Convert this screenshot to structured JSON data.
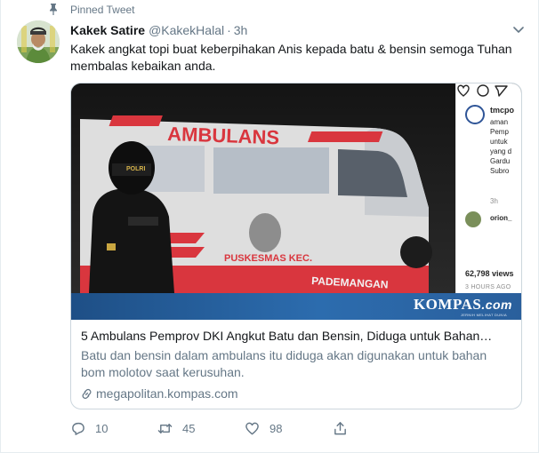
{
  "pinned": {
    "label": "Pinned Tweet"
  },
  "tweet": {
    "display_name": "Kakek Satire",
    "username": "@KakekHalal",
    "separator": "·",
    "time": "3h",
    "text": "Kakek angkat topi buat keberpihakan Anis kepada batu & bensin semoga Tuhan membalas kebaikan anda."
  },
  "media": {
    "ambulance_label": "AMBULANS",
    "vehicle_side_text": "PADEMANGAN",
    "vehicle_side_text_left": "PUSKESMAS KEC.",
    "helmet_label": "POLRI",
    "watermark": {
      "brand": "KOMPAS",
      "suffix": ".com",
      "tagline": "JERNIH MELIHAT DUNIA"
    },
    "instagram": {
      "handle": "tmcpo",
      "caption_lines": [
        "aman",
        "Pemp",
        "untuk",
        "yang d",
        "Gardu",
        "Subro"
      ],
      "time": "3h",
      "commenter": "orion_",
      "views": "62,798 views",
      "ago": "3 HOURS AGO"
    }
  },
  "card": {
    "title": "5 Ambulans Pemprov DKI Angkut Batu dan Bensin, Diduga untuk Bahan…",
    "description": "Batu dan bensin dalam ambulans itu diduga akan digunakan untuk bahan bom molotov saat kerusuhan.",
    "domain": "megapolitan.kompas.com"
  },
  "actions": {
    "replies": "10",
    "retweets": "45",
    "likes": "98"
  },
  "colors": {
    "text_primary": "#14171a",
    "text_secondary": "#657786",
    "border": "#ccd6dd",
    "kompas_blue": "#2c6cae",
    "ambulance_red": "#d9363e"
  },
  "icons": [
    "pin-icon",
    "caret-down-icon",
    "reply-icon",
    "retweet-icon",
    "heart-icon",
    "share-icon",
    "link-icon"
  ]
}
